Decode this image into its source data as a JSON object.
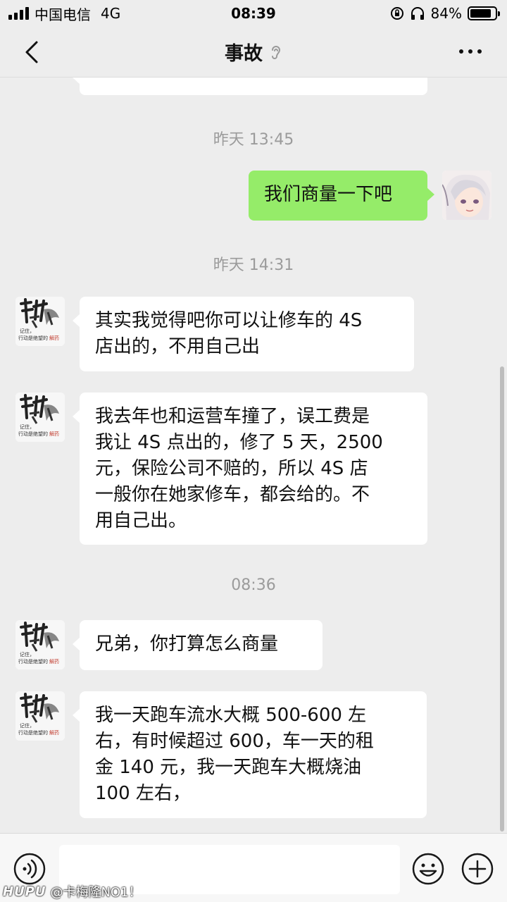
{
  "status_bar": {
    "carrier": "中国电信",
    "network": "4G",
    "time": "08:39",
    "battery": "84%",
    "battery_level": 0.84
  },
  "header": {
    "title": "事故",
    "back_icon": "chevron-left-icon",
    "mute_icon": "ear-icon",
    "more_icon": "more-dots-icon"
  },
  "messages": {
    "partial_top": "...",
    "ts1": "昨天 13:45",
    "m1": "我们商量一下吧",
    "ts2": "昨天 14:31",
    "m2_l1": "其实我觉得吧你可以让修车的 4S",
    "m2_l2": "店出的，不用自己出",
    "m3_l1": "我去年也和运营车撞了，误工费是",
    "m3_l2": "我让 4S 点出的，修了 5 天，2500",
    "m3_l3": "元，保险公司不赔的，所以 4S 店",
    "m3_l4": "一般你在她家修车，都会给的。不",
    "m3_l5": "用自己出。",
    "ts3": "08:36",
    "m4": "兄弟，你打算怎么商量",
    "m5_l1": "我一天跑车流水大概 500-600 左",
    "m5_l2": "右，有时候超过 600，车一天的租",
    "m5_l3": "金 140 元，我一天跑车大概烧油",
    "m5_l4": "100 左右，"
  },
  "avatar_text": {
    "line1": "记住，",
    "line2": "行动是绝望的",
    "line3": "解药"
  },
  "input_bar": {
    "voice_icon": "voice-icon",
    "emoji_icon": "emoji-icon",
    "plus_icon": "plus-icon"
  },
  "watermark": {
    "brand": "HUPU",
    "user": "@卡梅隆NO1！"
  },
  "colors": {
    "background": "#ededed",
    "sent_bubble": "#95ec69",
    "received_bubble": "#ffffff"
  }
}
